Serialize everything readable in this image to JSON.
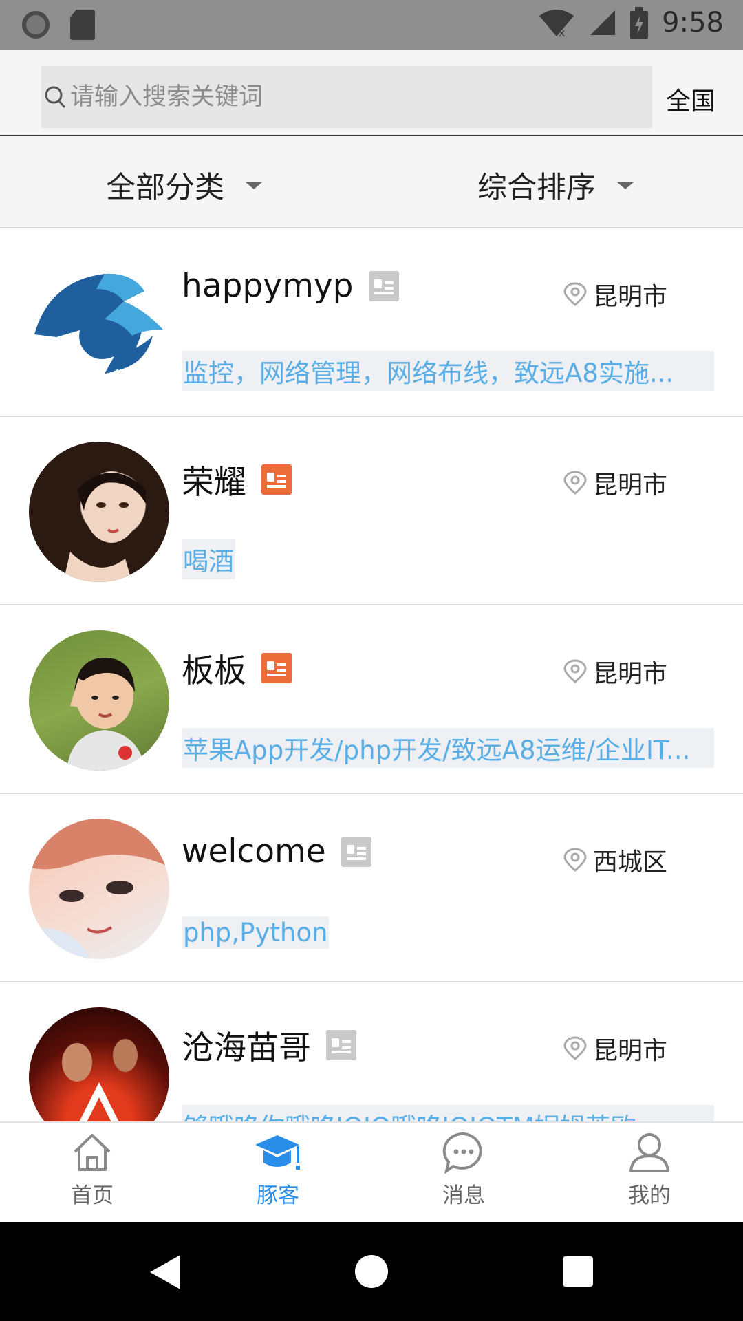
{
  "status_bar": {
    "time": "9:58"
  },
  "search": {
    "placeholder": "请输入搜索关键词",
    "region": "全国"
  },
  "filters": {
    "category": "全部分类",
    "sort": "综合排序"
  },
  "users": [
    {
      "name": "happymyp",
      "card_icon": "id-card-gray",
      "location": "昆明市",
      "tags": "监控，网络管理，网络布线，致远A8实施..."
    },
    {
      "name": "荣耀",
      "card_icon": "id-card-orange",
      "location": "昆明市",
      "tags": "喝酒"
    },
    {
      "name": "板板",
      "card_icon": "id-card-orange",
      "location": "昆明市",
      "tags": "苹果App开发/php开发/致远A8运维/企业IT..."
    },
    {
      "name": "welcome",
      "card_icon": "id-card-gray",
      "location": "西城区",
      "tags": "php,Python"
    },
    {
      "name": "沧海苗哥",
      "card_icon": "id-card-gray",
      "location": "昆明市",
      "tags": "够哦咯你哦咯JQJQ哦咯JQJQTM妮姆英欧"
    }
  ],
  "bottom_nav": [
    {
      "label": "首页",
      "icon": "home-icon",
      "active": false
    },
    {
      "label": "豚客",
      "icon": "graduation-cap-icon",
      "active": true
    },
    {
      "label": "消息",
      "icon": "chat-icon",
      "active": false
    },
    {
      "label": "我的",
      "icon": "user-icon",
      "active": false
    }
  ],
  "colors": {
    "accent": "#2a8ee8",
    "tag_text": "#5aaee6",
    "badge_orange": "#ec6d3a",
    "badge_gray": "#c9c9c9"
  }
}
